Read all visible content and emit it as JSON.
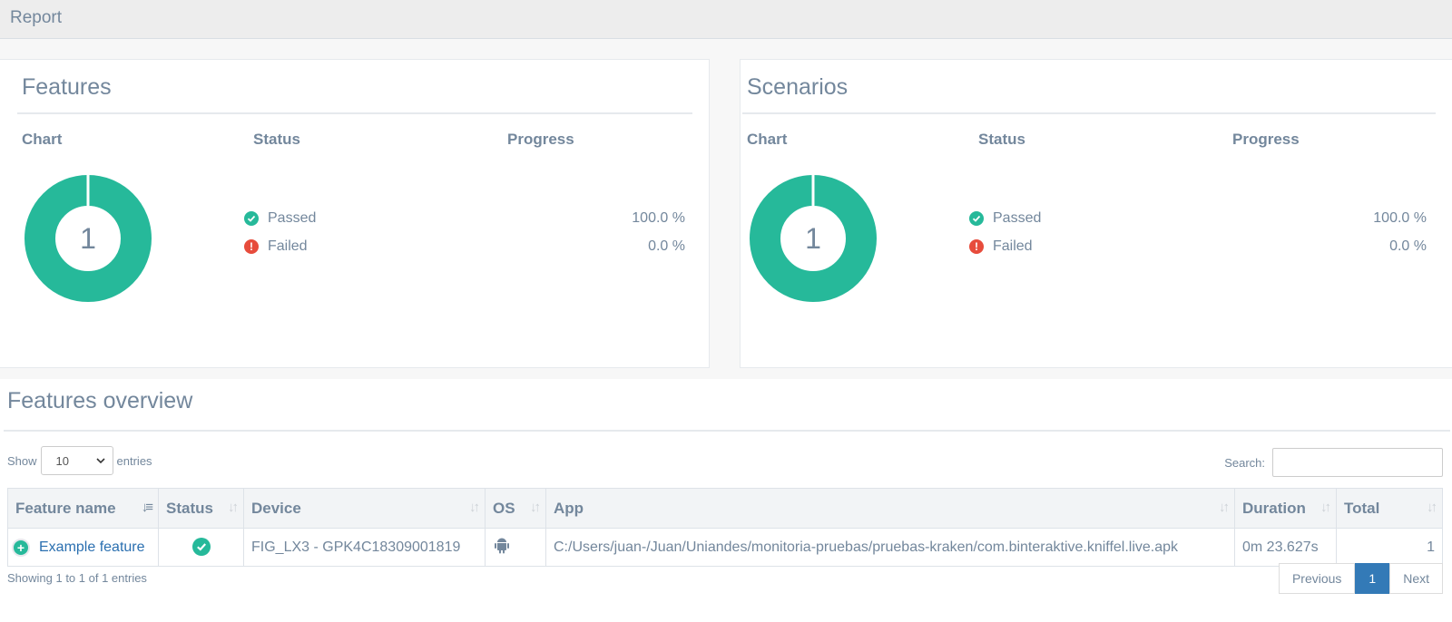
{
  "header": {
    "title": "Report"
  },
  "features_panel": {
    "title": "Features",
    "col_chart": "Chart",
    "col_status": "Status",
    "col_progress": "Progress",
    "donut_value": "1",
    "donut_passed_fraction": 1.0,
    "passed_label": "Passed",
    "passed_pct": "100.0 %",
    "failed_label": "Failed",
    "failed_pct": "0.0 %"
  },
  "scenarios_panel": {
    "title": "Scenarios",
    "col_chart": "Chart",
    "col_status": "Status",
    "col_progress": "Progress",
    "donut_value": "1",
    "donut_passed_fraction": 1.0,
    "passed_label": "Passed",
    "passed_pct": "100.0 %",
    "failed_label": "Failed",
    "failed_pct": "0.0 %"
  },
  "overview": {
    "title": "Features overview",
    "show_label": "Show",
    "entries_label": "entries",
    "page_size": "10",
    "search_label": "Search:",
    "search_value": "",
    "columns": [
      "Feature name",
      "Status",
      "Device",
      "OS",
      "App",
      "Duration",
      "Total"
    ],
    "rows": [
      {
        "feature_name": "Example feature",
        "status": "passed",
        "device": "FIG_LX3 - GPK4C18309001819",
        "os": "android",
        "app": "C:/Users/juan-/Juan/Uniandes/monitoria-pruebas/pruebas-kraken/com.binteraktive.kniffel.live.apk",
        "duration": "0m 23.627s",
        "total": "1"
      }
    ],
    "info": "Showing 1 to 1 of 1 entries",
    "pager": {
      "previous": "Previous",
      "current": "1",
      "next": "Next"
    }
  },
  "colors": {
    "passed": "#26b99a",
    "failed": "#e74c3c",
    "text": "#73879c",
    "link": "#2a6fb0",
    "pager_active": "#337ab7"
  },
  "icons": {
    "passed": "check-circle-icon",
    "failed": "exclamation-circle-icon",
    "os": "android-icon",
    "expand": "plus-circle-icon"
  }
}
